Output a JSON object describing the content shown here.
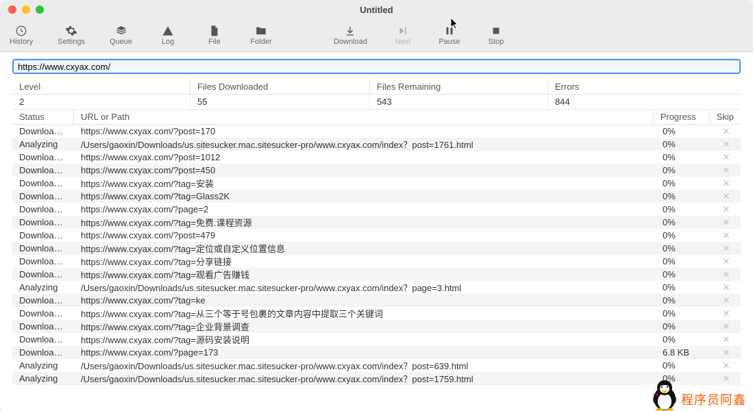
{
  "window_title": "Untitled",
  "toolbar": {
    "history": "History",
    "settings": "Settings",
    "queue": "Queue",
    "log": "Log",
    "file": "File",
    "folder": "Folder",
    "download": "Download",
    "next": "Next",
    "pause": "Pause",
    "stop": "Stop"
  },
  "url_value": "https://www.cxyax.com/",
  "summary": {
    "headers": {
      "level": "Level",
      "downloaded": "Files Downloaded",
      "remaining": "Files Remaining",
      "errors": "Errors"
    },
    "values": {
      "level": "2",
      "downloaded": "55",
      "remaining": "543",
      "errors": "844"
    }
  },
  "detail_headers": {
    "status": "Status",
    "url": "URL or Path",
    "progress": "Progress",
    "skip": "Skip"
  },
  "rows": [
    {
      "status": "Downloading",
      "url": "https://www.cxyax.com/?post=170",
      "progress": "0%"
    },
    {
      "status": "Analyzing",
      "url": "/Users/gaoxin/Downloads/us.sitesucker.mac.sitesucker-pro/www.cxyax.com/index？post=1761.html",
      "progress": "0%"
    },
    {
      "status": "Downloading",
      "url": "https://www.cxyax.com/?post=1012",
      "progress": "0%"
    },
    {
      "status": "Downloading",
      "url": "https://www.cxyax.com/?post=450",
      "progress": "0%"
    },
    {
      "status": "Downloading",
      "url": "https://www.cxyax.com/?tag=安装",
      "progress": "0%"
    },
    {
      "status": "Downloading",
      "url": "https://www.cxyax.com/?tag=Glass2K",
      "progress": "0%"
    },
    {
      "status": "Downloading",
      "url": "https://www.cxyax.com/?page=2",
      "progress": "0%"
    },
    {
      "status": "Downloading",
      "url": "https://www.cxyax.com/?tag=免费.课程资源",
      "progress": "0%"
    },
    {
      "status": "Downloading",
      "url": "https://www.cxyax.com/?post=479",
      "progress": "0%"
    },
    {
      "status": "Downloading",
      "url": "https://www.cxyax.com/?tag=定位或自定义位置信息",
      "progress": "0%"
    },
    {
      "status": "Downloading",
      "url": "https://www.cxyax.com/?tag=分享链接",
      "progress": "0%"
    },
    {
      "status": "Downloading",
      "url": "https://www.cxyax.com/?tag=观看广告赚钱",
      "progress": "0%"
    },
    {
      "status": "Analyzing",
      "url": "/Users/gaoxin/Downloads/us.sitesucker.mac.sitesucker-pro/www.cxyax.com/index？page=3.html",
      "progress": "0%"
    },
    {
      "status": "Downloading",
      "url": "https://www.cxyax.com/?tag=ke",
      "progress": "0%"
    },
    {
      "status": "Downloading",
      "url": "https://www.cxyax.com/?tag=从三个等于号包裹的文章内容中提取三个关键词",
      "progress": "0%"
    },
    {
      "status": "Downloading",
      "url": "https://www.cxyax.com/?tag=企业背景调查",
      "progress": "0%"
    },
    {
      "status": "Downloading",
      "url": "https://www.cxyax.com/?tag=源码安装说明",
      "progress": "0%"
    },
    {
      "status": "Downloading",
      "url": "https://www.cxyax.com/?page=173",
      "progress": "6.8 KB"
    },
    {
      "status": "Analyzing",
      "url": "/Users/gaoxin/Downloads/us.sitesucker.mac.sitesucker-pro/www.cxyax.com/index？post=639.html",
      "progress": "0%"
    },
    {
      "status": "Analyzing",
      "url": "/Users/gaoxin/Downloads/us.sitesucker.mac.sitesucker-pro/www.cxyax.com/index？post=1759.html",
      "progress": "0%"
    }
  ],
  "watermark": "程序员阿鑫"
}
